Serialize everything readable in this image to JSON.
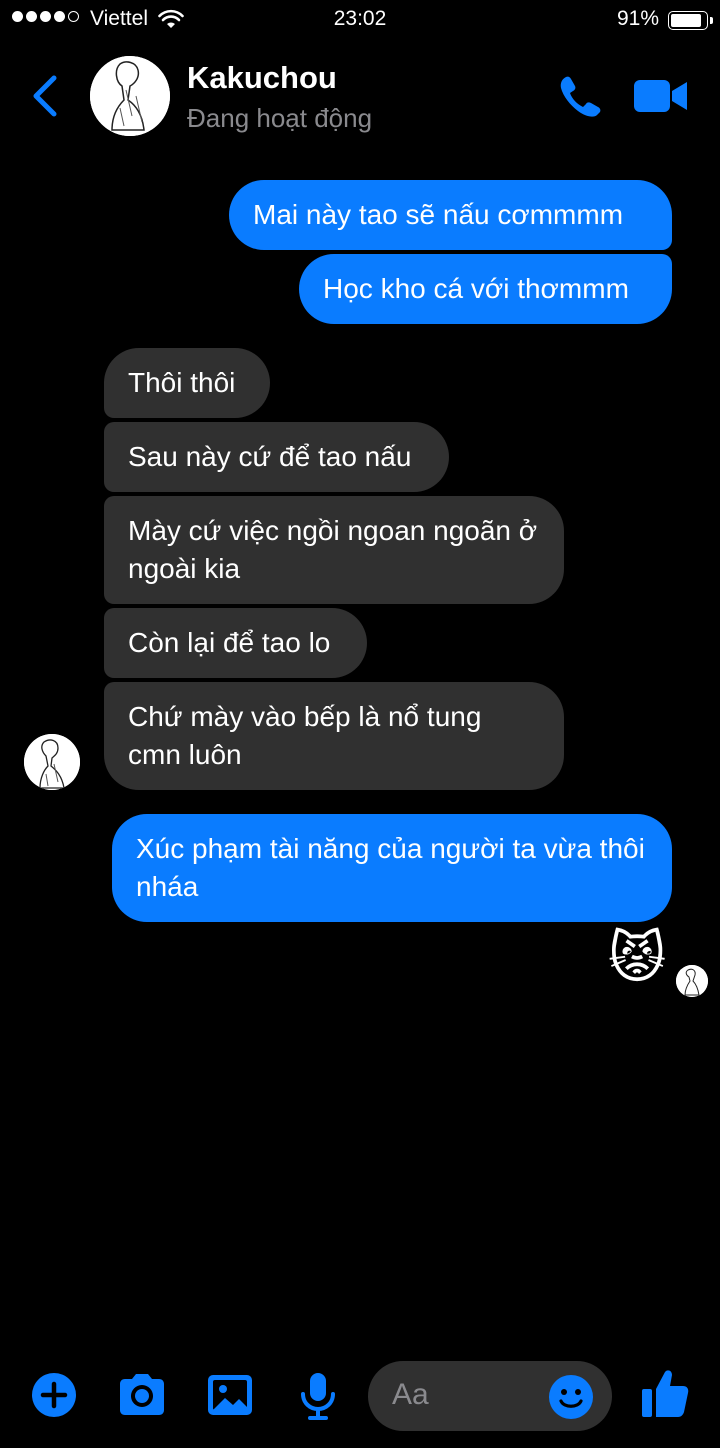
{
  "status_bar": {
    "carrier": "Viettel",
    "time": "23:02",
    "battery_percent": "91%",
    "battery_level": 0.91
  },
  "header": {
    "contact_name": "Kakuchou",
    "presence": "Đang hoạt động"
  },
  "messages": [
    {
      "side": "out",
      "text": "Mai này tao sẽ nấu cơmmmm"
    },
    {
      "side": "out",
      "text": "Học kho cá với thơmmm"
    },
    {
      "side": "in",
      "text": "Thôi thôi"
    },
    {
      "side": "in",
      "text": "Sau này cứ để tao nấu"
    },
    {
      "side": "in",
      "text": "Mày cứ việc ngồi ngoan ngoãn ở ngoài kia"
    },
    {
      "side": "in",
      "text": "Còn lại để tao lo"
    },
    {
      "side": "in",
      "text": "Chứ mày vào bếp là nổ tung cmn luôn"
    },
    {
      "side": "out",
      "text": "Xúc phạm tài năng của người ta vừa thôi nháa"
    },
    {
      "side": "out",
      "text": "😾"
    }
  ],
  "composer": {
    "placeholder": "Aa"
  },
  "icons": {
    "back": "chevron-left-icon",
    "call": "phone-icon",
    "video": "video-camera-icon",
    "add": "plus-icon",
    "camera": "camera-icon",
    "gallery": "image-icon",
    "mic": "microphone-icon",
    "emoji": "smiley-icon",
    "like": "thumbs-up-icon"
  },
  "colors": {
    "accent": "#0a7cff",
    "incoming_bubble": "#303030",
    "background": "#000000",
    "secondary_text": "#8a8a8e"
  }
}
